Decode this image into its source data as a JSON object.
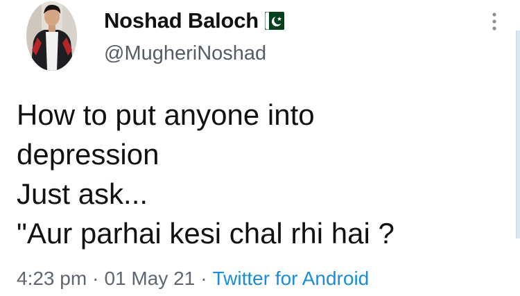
{
  "author": {
    "display_name": "Noshad Baloch",
    "handle": "@MugheriNoshad",
    "badge_icon": "pakistan-flag-icon",
    "avatar_icon": "profile-photo"
  },
  "tweet": {
    "lines": [
      "How to put anyone into",
      "depression",
      "Just ask...",
      "\"Aur parhai kesi chal rhi hai ?"
    ]
  },
  "meta": {
    "time": "4:23 pm",
    "date": "01 May 21",
    "separator": "·",
    "source": "Twitter for Android"
  },
  "menu": {
    "icon": "more-options-icon"
  },
  "colors": {
    "text": "#111111",
    "secondary_text": "#555c63",
    "link": "#1a8cd8",
    "flag_green": "#01411c"
  }
}
